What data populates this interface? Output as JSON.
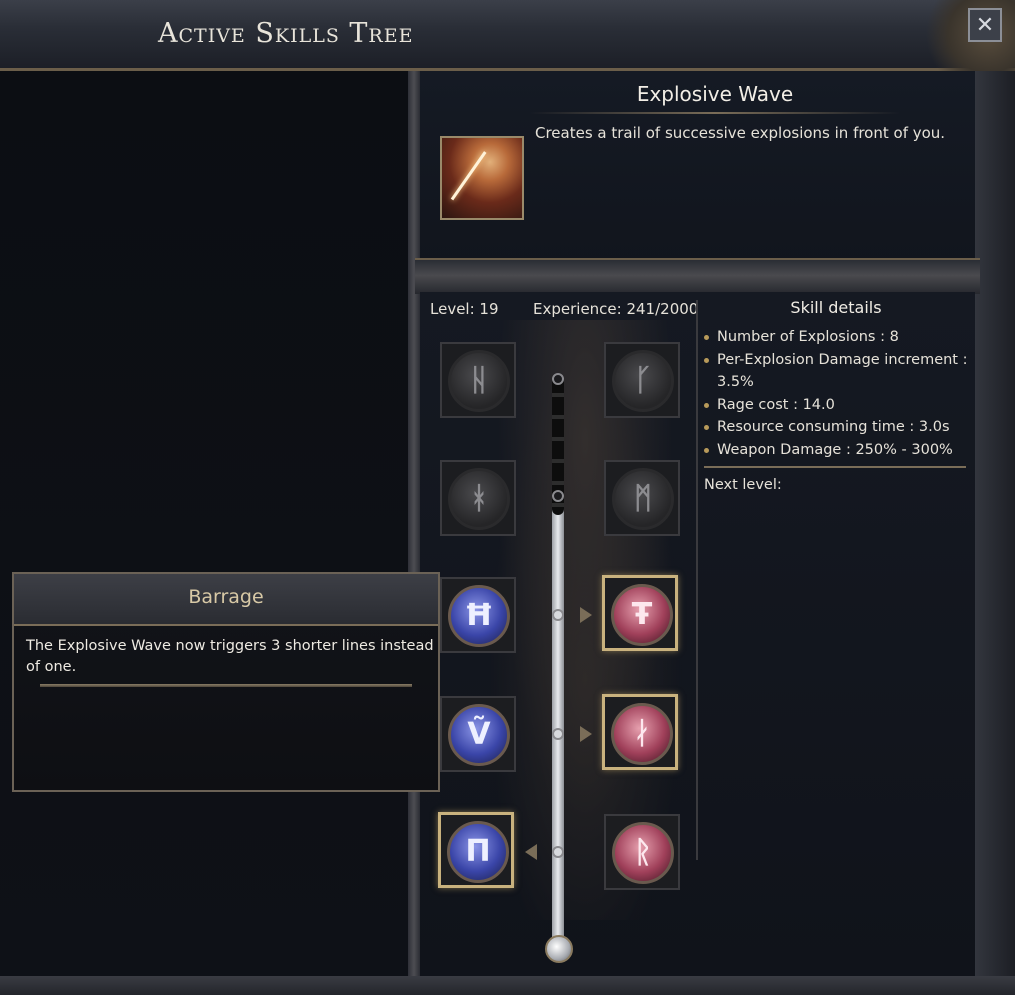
{
  "window": {
    "title": "Active Skills Tree",
    "close_symbol": "✕"
  },
  "skill": {
    "name": "Explosive Wave",
    "description": "Creates a trail of successive explosions in front of you.",
    "icon": "explosive-wave-icon"
  },
  "progress": {
    "level_text": "Level: 19",
    "experience_text": "Experience: 241/2000",
    "level": 19,
    "experience_current": 241,
    "experience_max": 2000
  },
  "details": {
    "title": "Skill details",
    "items": [
      "Number of Explosions : 8",
      "Per-Explosion Damage increment : 3.5%",
      "Rage cost : 14.0",
      "Resource consuming time : 3.0s",
      "Weapon Damage : 250% - 300%"
    ],
    "next_level_label": "Next level:"
  },
  "runes": [
    {
      "glyph": "ᚺ",
      "color": "gray",
      "selected": false
    },
    {
      "glyph": "ᚴ",
      "color": "gray",
      "selected": false
    },
    {
      "glyph": "ᚼ",
      "color": "gray",
      "selected": false
    },
    {
      "glyph": "ᛗ",
      "color": "gray",
      "selected": false
    },
    {
      "glyph": "Ħ",
      "color": "blue",
      "selected": false
    },
    {
      "glyph": "Ŧ",
      "color": "red",
      "selected": true
    },
    {
      "glyph": "Ṽ",
      "color": "blue",
      "selected": false
    },
    {
      "glyph": "ᛅ",
      "color": "red",
      "selected": true
    },
    {
      "glyph": "Π",
      "color": "blue",
      "selected": true
    },
    {
      "glyph": "ᚱ",
      "color": "red",
      "selected": false
    }
  ],
  "tooltip": {
    "title": "Barrage",
    "text": "The Explosive Wave now triggers 3 shorter lines instead of one."
  },
  "colors": {
    "gold_border": "#c9b27e",
    "rune_blue": "#3a45a8",
    "rune_red": "#a0405a",
    "text": "#e6e2d9"
  }
}
